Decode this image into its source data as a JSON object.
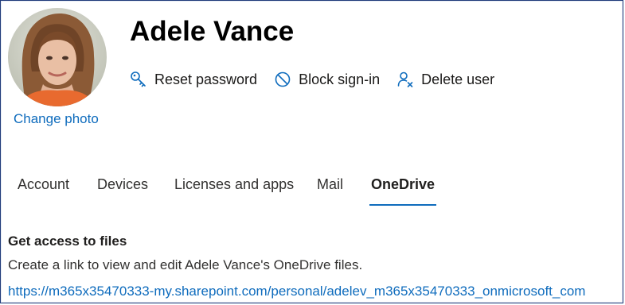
{
  "user": {
    "display_name": "Adele Vance",
    "change_photo_label": "Change photo"
  },
  "actions": [
    {
      "label": "Reset password",
      "icon": "key-icon"
    },
    {
      "label": "Block sign-in",
      "icon": "block-icon"
    },
    {
      "label": "Delete user",
      "icon": "person-delete-icon"
    }
  ],
  "tabs": [
    {
      "label": "Account",
      "active": false
    },
    {
      "label": "Devices",
      "active": false
    },
    {
      "label": "Licenses and apps",
      "active": false
    },
    {
      "label": "Mail",
      "active": false
    },
    {
      "label": "OneDrive",
      "active": true
    }
  ],
  "onedrive": {
    "heading": "Get access to files",
    "description": "Create a link to view and edit Adele Vance's OneDrive files.",
    "link": "https://m365x35470333-my.sharepoint.com/personal/adelev_m365x35470333_onmicrosoft_com"
  },
  "colors": {
    "accent": "#0f6cbd",
    "text": "#323130",
    "frame": "#1f3a7a"
  }
}
